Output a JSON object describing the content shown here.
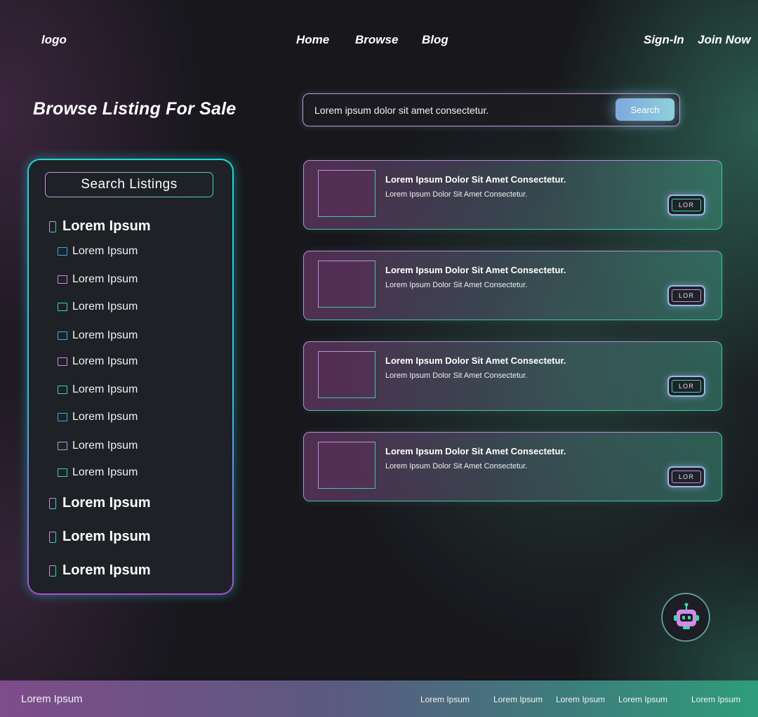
{
  "header": {
    "logo": "logo",
    "nav": [
      "Home",
      "Browse",
      "Blog"
    ],
    "sign_in": "Sign-In",
    "join_now": "Join Now"
  },
  "page_title": "Browse Listing For Sale",
  "search": {
    "value": "Lorem ipsum dolor sit amet consectetur.",
    "button_label": "Search"
  },
  "sidebar": {
    "search_placeholder": "Search Listings",
    "categories": [
      {
        "label": "Lorem Ipsum",
        "items": [
          "Lorem Ipsum",
          "Lorem Ipsum",
          "Lorem Ipsum",
          "Lorem Ipsum",
          "Lorem Ipsum",
          "Lorem Ipsum",
          "Lorem Ipsum",
          "Lorem Ipsum",
          "Lorem Ipsum"
        ]
      },
      {
        "label": "Lorem Ipsum"
      },
      {
        "label": "Lorem Ipsum"
      },
      {
        "label": "Lorem Ipsum"
      }
    ]
  },
  "listings": [
    {
      "title": "Lorem Ipsum Dolor Sit Amet Consectetur.",
      "description": "Lorem Ipsum Dolor Sit Amet Consectetur.",
      "tag": "LOR"
    },
    {
      "title": "Lorem Ipsum Dolor Sit Amet Consectetur.",
      "description": "Lorem Ipsum Dolor Sit Amet Consectetur.",
      "tag": "LOR"
    },
    {
      "title": "Lorem Ipsum Dolor Sit Amet Consectetur.",
      "description": "Lorem Ipsum Dolor Sit Amet Consectetur.",
      "tag": "LOR"
    },
    {
      "title": "Lorem Ipsum Dolor Sit Amet Consectetur.",
      "description": "Lorem Ipsum Dolor Sit Amet Consectetur.",
      "tag": "LOR"
    }
  ],
  "chatbot": {
    "icon": "robot-icon"
  },
  "footer": {
    "brand": "Lorem Ipsum",
    "links": [
      "Lorem Ipsum",
      "Lorem Ipsum",
      "Lorem Ipsum",
      "Lorem Ipsum",
      "Lorem Ipsum"
    ]
  },
  "colors": {
    "accent_cyan": "#1fd8d8",
    "accent_green": "#3cd8b0",
    "accent_pink": "#d48be6",
    "background": "#17171c"
  }
}
